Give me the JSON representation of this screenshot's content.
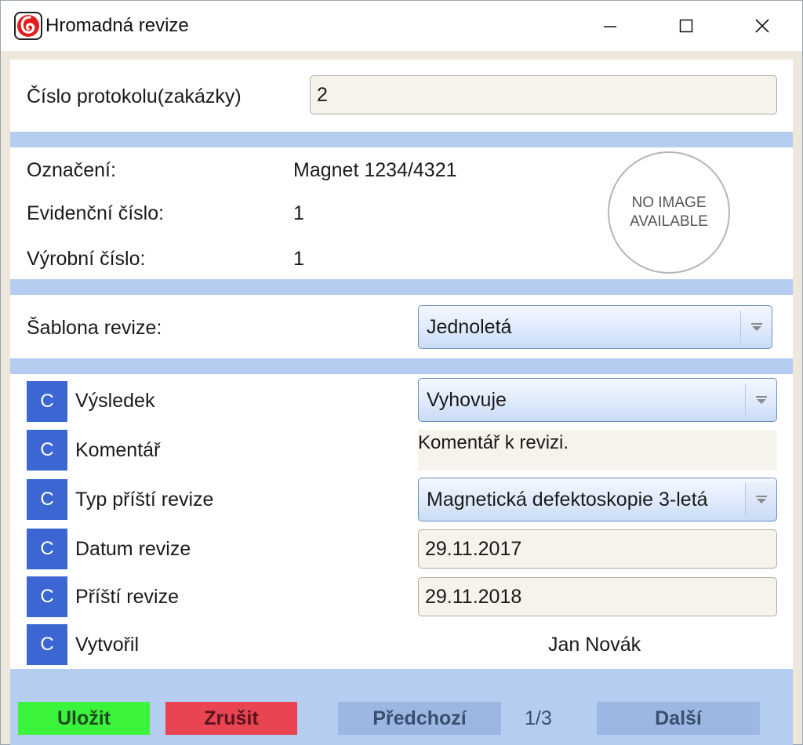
{
  "window": {
    "title": "Hromadná revize"
  },
  "protocol": {
    "label": "Číslo protokolu(zakázky)",
    "value": "2"
  },
  "item": {
    "designation_label": "Označení:",
    "designation_value": "Magnet 1234/4321",
    "evidence_label": "Evidenční číslo:",
    "evidence_value": "1",
    "serial_label": "Výrobní číslo:",
    "serial_value": "1",
    "image_placeholder": "NO IMAGE AVAILABLE"
  },
  "template": {
    "label": "Šablona revize:",
    "selected": "Jednoletá"
  },
  "rows": {
    "clear_label": "C",
    "result": {
      "label": "Výsledek",
      "selected": "Vyhovuje"
    },
    "comment": {
      "label": "Komentář",
      "value": "Komentář k revizi."
    },
    "next_type": {
      "label": "Typ příští revize",
      "selected": "Magnetická defektoskopie 3-letá"
    },
    "date": {
      "label": "Datum revize",
      "value": "29.11.2017"
    },
    "next_date": {
      "label": "Příští revize",
      "value": "29.11.2018"
    },
    "created_by": {
      "label": "Vytvořil",
      "value": "Jan Novák"
    }
  },
  "footer": {
    "save_label": "Uložit",
    "cancel_label": "Zrušit",
    "prev_label": "Předchozí",
    "pager": "1/3",
    "next_label": "Další"
  },
  "colors": {
    "accent_band": "#b5cdf0",
    "clear_button": "#3c67d2",
    "save_button": "#3cf33c",
    "cancel_button": "#e84452",
    "nav_button": "#9cb7e2"
  },
  "icons": {
    "app": "app-logo-icon",
    "minimize": "minimize-icon",
    "maximize": "maximize-icon",
    "close": "close-icon",
    "dropdown": "dropdown-arrow-icon"
  }
}
